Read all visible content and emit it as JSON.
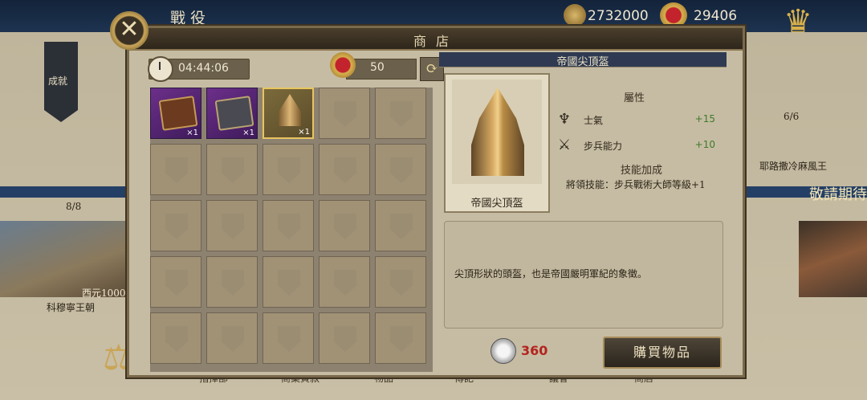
{
  "top": {
    "title": "戰役",
    "gold": "2732000",
    "crowns": "29406"
  },
  "side": {
    "achievement_label": "成就",
    "progress_left": "8/8",
    "progress_right": "6/6",
    "dynasty_label": "科穆寧王朝",
    "era_label": "西元1000",
    "right_label": "耶路撒冷麻風王",
    "coming_label": "敬請期待"
  },
  "shop": {
    "title": "商店",
    "timer": "04:44:06",
    "tokens": "50",
    "grid": {
      "rows": 5,
      "cols": 5,
      "items": [
        {
          "name": "book-purple",
          "qty": "×1"
        },
        {
          "name": "book-grey",
          "qty": "×1"
        },
        {
          "name": "helmet",
          "qty": "×1",
          "selected": true
        }
      ]
    }
  },
  "detail": {
    "item_name": "帝國尖頂盔",
    "portrait_label": "帝國尖頂盔",
    "attributes_heading": "屬性",
    "attributes": [
      {
        "icon": "eagle-icon",
        "name": "士氣",
        "value": "+15"
      },
      {
        "icon": "crossed-swords-icon",
        "name": "步兵能力",
        "value": "+10"
      }
    ],
    "skill_heading": "技能加成",
    "skill_text": "將領技能：步兵戰術大師等級+1",
    "description": "尖頂形狀的頭盔，也是帝國嚴明軍紀的象徵。",
    "price": "360",
    "buy_label": "購買物品"
  },
  "bottom_tabs": [
    "指揮部",
    "商業貸款",
    "物品",
    "傳記",
    "議會",
    "商店"
  ],
  "colors": {
    "price": "#b3241f",
    "attr_value": "#3f7a2d",
    "selected_border": "#e8c560"
  }
}
